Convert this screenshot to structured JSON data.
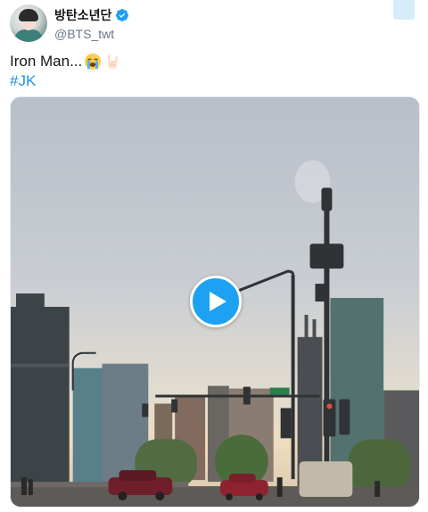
{
  "tweet": {
    "display_name": "방탄소년단",
    "handle": "@BTS_twt",
    "text": "Iron Man...",
    "emojis": [
      "loudly-crying-face-icon",
      "sign-of-the-horns-icon"
    ],
    "hashtag": "#JK"
  },
  "icons": {
    "verified": "verified-badge-icon",
    "caret": "caret-down-icon",
    "play": "play-icon"
  },
  "colors": {
    "accent": "#1da1f2",
    "hashtag": "#1b95e0",
    "handle": "#657786",
    "text": "#14171a"
  }
}
